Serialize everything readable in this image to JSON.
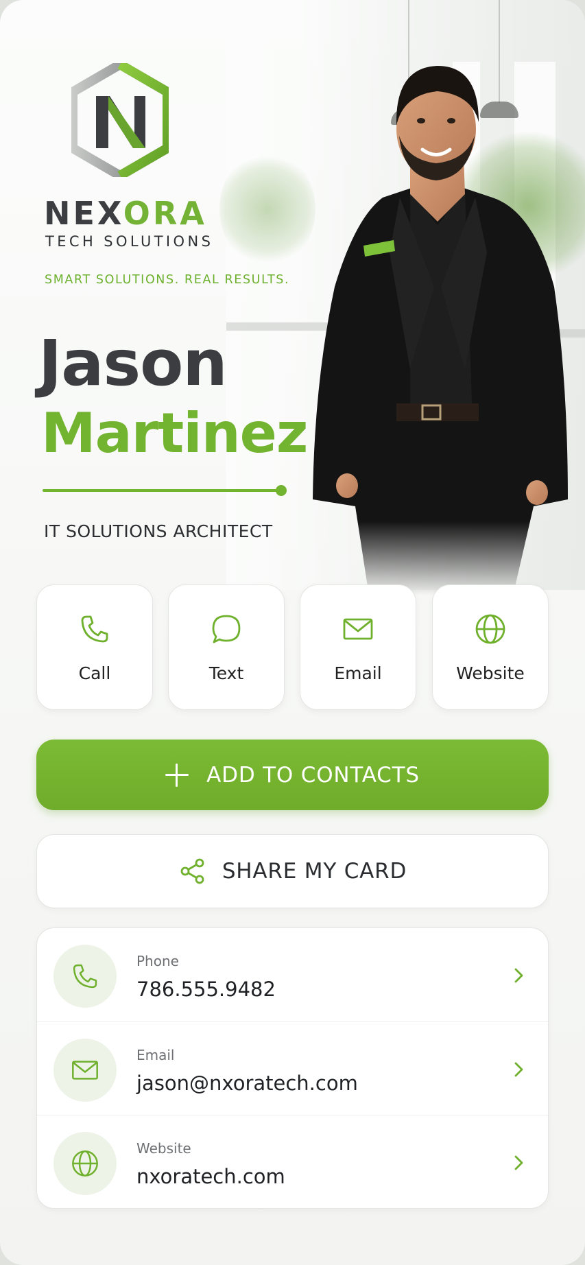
{
  "brand": {
    "name_main": "NEX",
    "name_accent": "ORA",
    "subtitle": "TECH SOLUTIONS",
    "tagline": "SMART SOLUTIONS. REAL RESULTS.",
    "accent_color": "#72b32f",
    "dark_color": "#3b3d40"
  },
  "person": {
    "first_name": "Jason",
    "last_name": "Martinez",
    "title": "IT SOLUTIONS ARCHITECT"
  },
  "actions": [
    {
      "label": "Call",
      "icon": "phone-icon"
    },
    {
      "label": "Text",
      "icon": "chat-bubble-icon"
    },
    {
      "label": "Email",
      "icon": "envelope-icon"
    },
    {
      "label": "Website",
      "icon": "globe-icon"
    }
  ],
  "buttons": {
    "add_contacts": "ADD TO CONTACTS",
    "share_card": "SHARE MY CARD"
  },
  "contact_rows": [
    {
      "label": "Phone",
      "value": "786.555.9482",
      "icon": "phone-icon"
    },
    {
      "label": "Email",
      "value": "jason@nxoratech.com",
      "icon": "envelope-icon"
    },
    {
      "label": "Website",
      "value": "nxoratech.com",
      "icon": "globe-icon"
    }
  ]
}
